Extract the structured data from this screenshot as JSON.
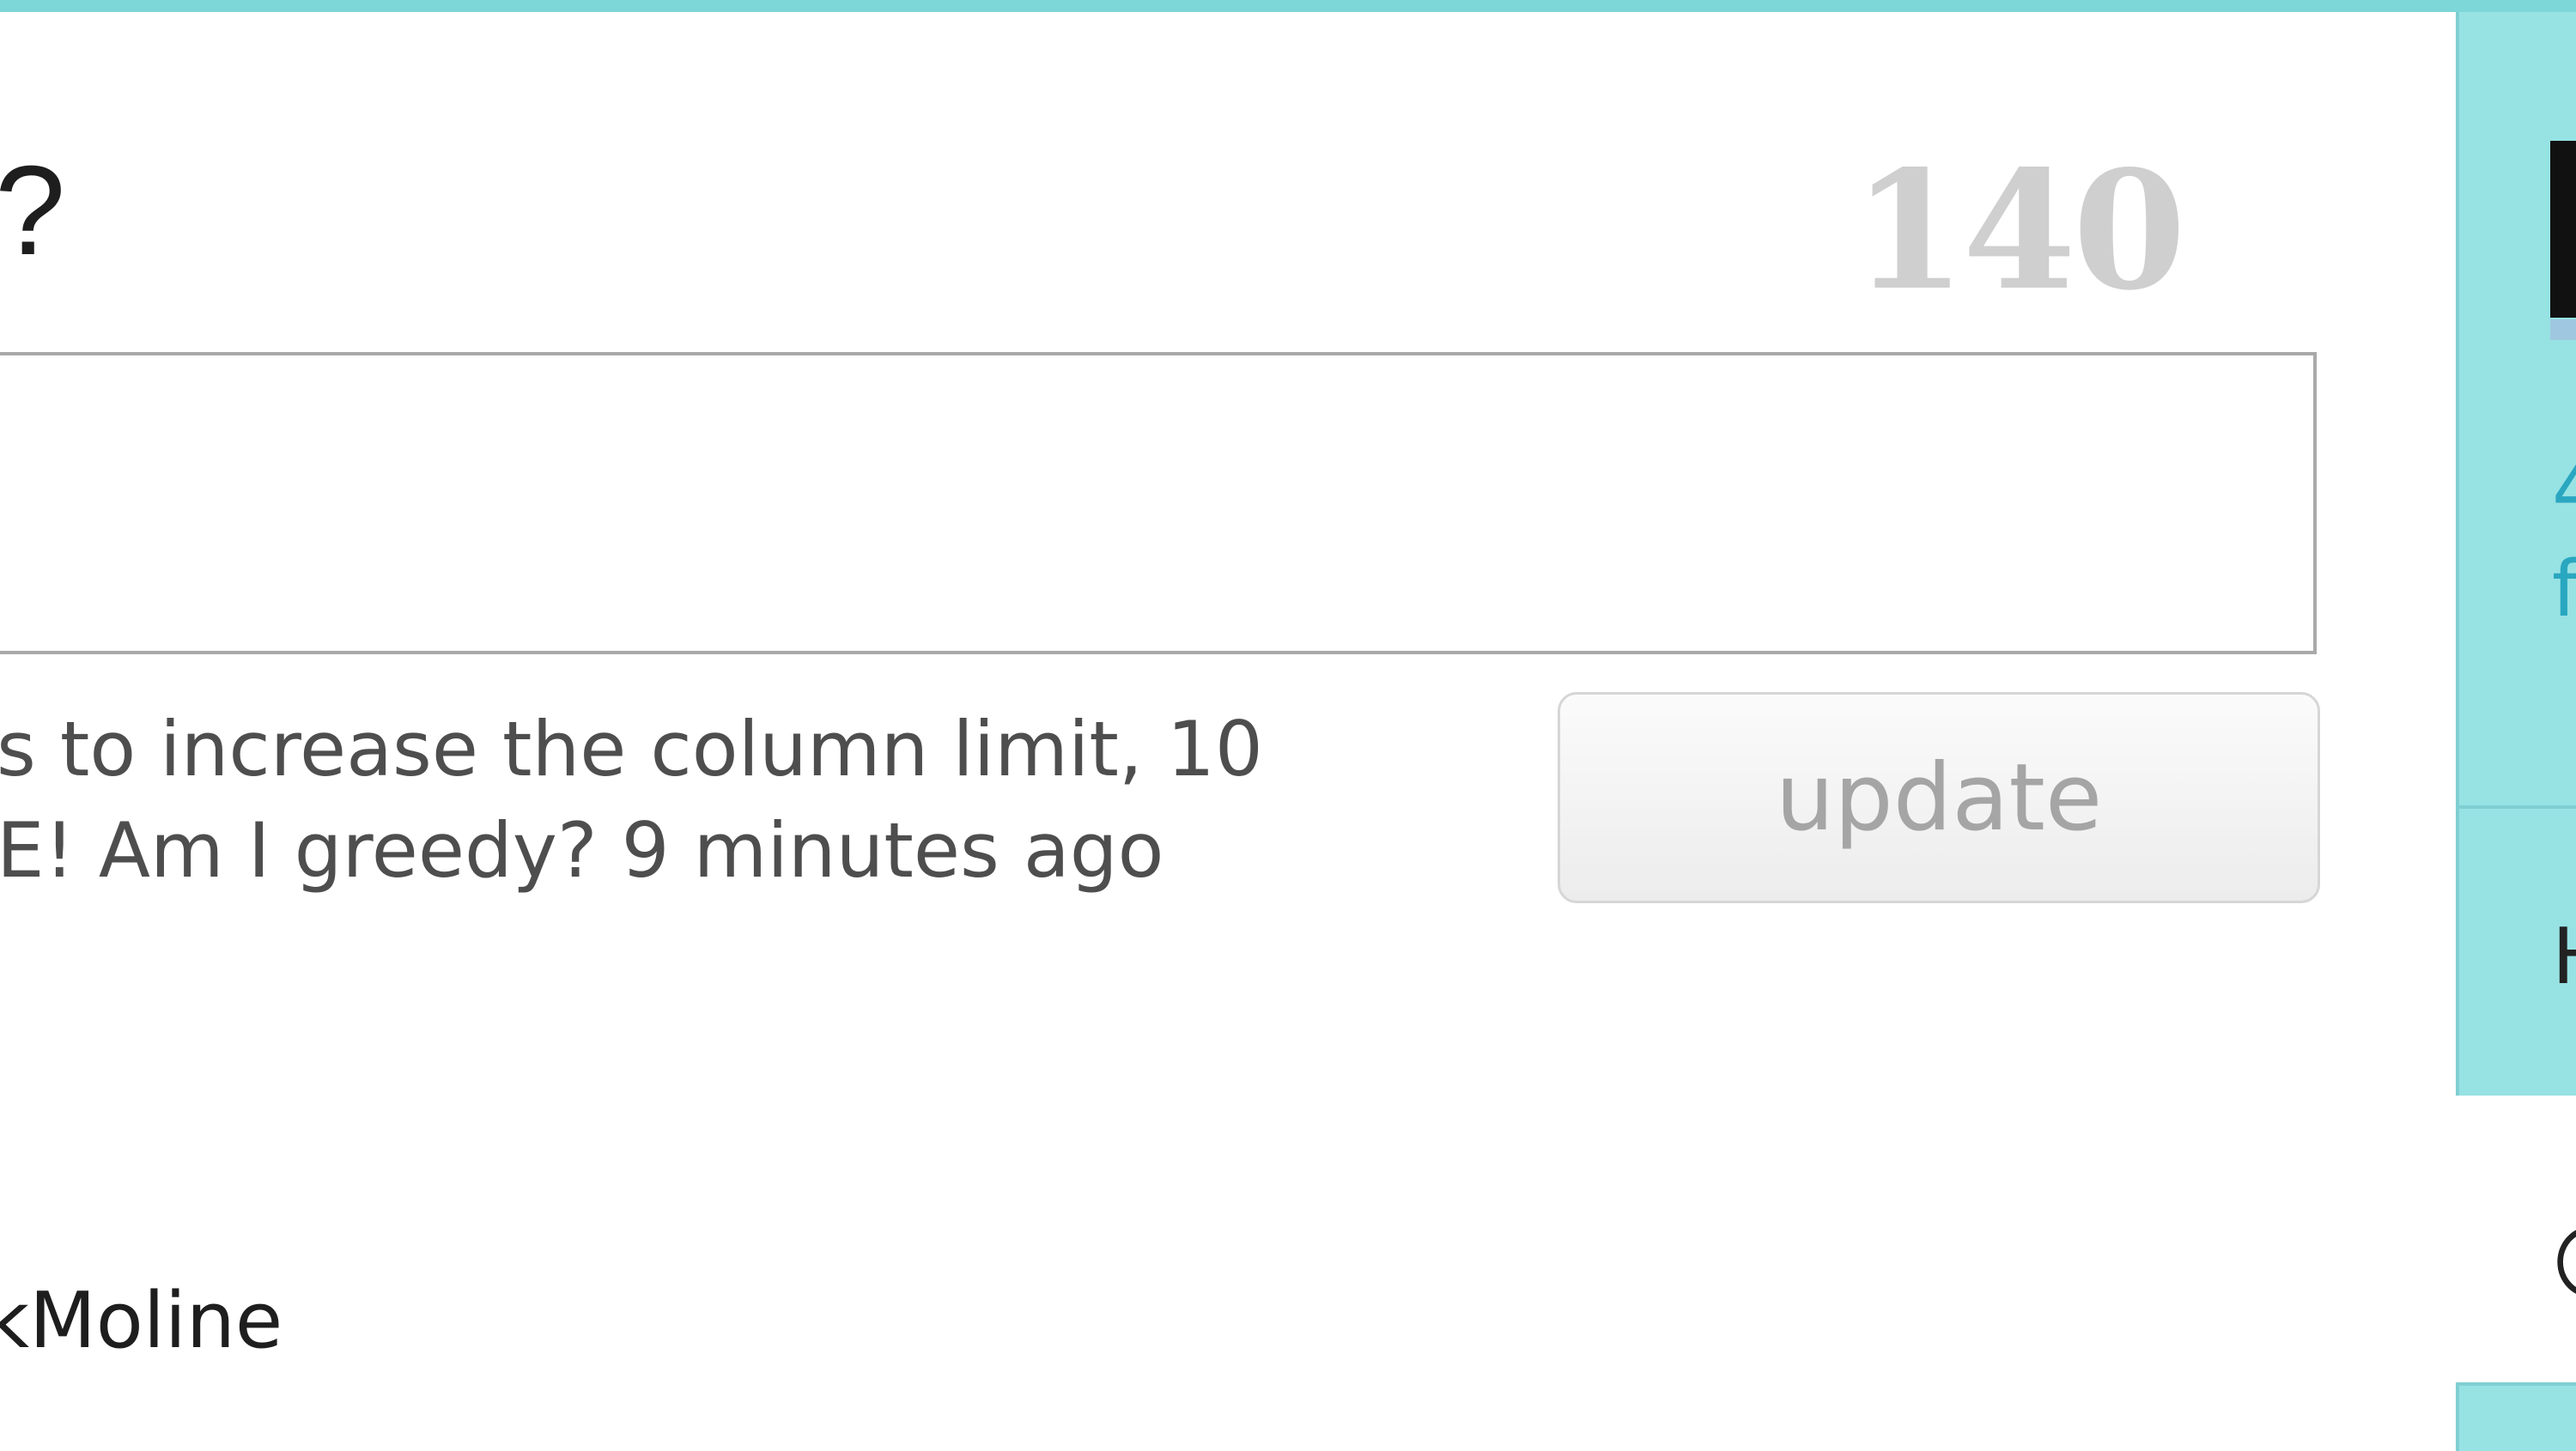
{
  "colors": {
    "accent_teal": "#7dd6d8",
    "sidebar_bg": "#97e2e3",
    "link_blue": "#2aa7c0",
    "counter_gray": "#cfcfcf",
    "button_text": "#a5a5a5"
  },
  "composer": {
    "heading_fragment": "?",
    "char_count": "140",
    "status_value": "",
    "update_label": "update"
  },
  "latest_status": {
    "line1": "s to increase the column limit, 10",
    "line2": "E! Am I greedy? 9 minutes ago"
  },
  "timeline": {
    "user_fragment": "kMoline"
  },
  "sidebar": {
    "link_line1": "4",
    "link_line2": "f",
    "heading_fragment": "H",
    "at_fragment": "@"
  }
}
